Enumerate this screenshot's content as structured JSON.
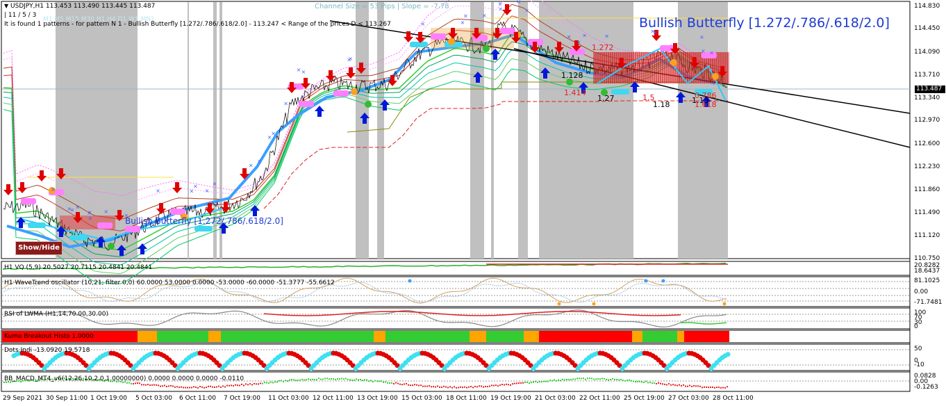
{
  "header": {
    "symbol_line": "USDJPY,H1  113.453 113.490 113.445 113.487",
    "sub_line": "| 11 / 5 / 3",
    "pattern_line": "It is found 1 patterns  -  for pattern N 1 - Bullish Butterfly [1.272/.786/.618/2.0] - 113.247 < Range of the prices D < 113.267",
    "faded_label": "M1 M5 M15 M30 H1 H4 D1 W1 MN1",
    "channel_info": "Channel Size = 53 Pips  |  Slope = -7.78"
  },
  "pattern_title": "Bullish Butterfly [1.272/.786/.618/2.0]",
  "old_pattern_label": "Bullish Butterfly [1.272/.786/.618/2.0]",
  "show_hide_label": "Show/Hide",
  "current_price": "113.487",
  "price_axis": [
    "114.830",
    "114.450",
    "114.090",
    "113.710",
    "113.340",
    "112.970",
    "112.600",
    "112.230",
    "111.860",
    "111.490",
    "111.120",
    "110.750"
  ],
  "fib_labels": [
    "1.272",
    "1.414",
    "1.27",
    "1.18",
    "1.618",
    "1.128",
    "1.5",
    "1.13",
    "0.786"
  ],
  "panes": {
    "vq": {
      "label": "H1 VQ (5,9) 20.5027 20.7115 20.4841 20.4841",
      "axis": [
        "20.8282",
        "18.6437"
      ]
    },
    "wavetrend": {
      "label": "H1 WaveTrend oscillator (10,21, filter 0,0) 60.0000 53.0000 0.0000 -53.0000 -60.0000 -51.3777 -55.6612",
      "axis": [
        "81.1025",
        "0.00",
        "-71.7481"
      ]
    },
    "rsi": {
      "label": "RSI of LWMA (H1,14,70.00,30.00)",
      "axis": [
        "100",
        "70",
        "30",
        "0"
      ]
    },
    "kumo": {
      "label": "Kumo Breakout Histo 1.0000"
    },
    "dots": {
      "label": "Dots Indi -13.0920 19.5718",
      "axis": [
        "50",
        "0",
        "-10"
      ]
    },
    "macd": {
      "label": "BB_MACD_MT4_v6(12,26,10,2.0,1.00000000) 0.0000 0.0000 0.0000 -0.0110",
      "axis": [
        "0.0828",
        "0.00",
        "-0.1263"
      ]
    }
  },
  "time_axis": [
    "29 Sep 2021",
    "30 Sep 11:00",
    "1 Oct 19:00",
    "5 Oct 03:00",
    "6 Oct 11:00",
    "7 Oct 19:00",
    "11 Oct 03:00",
    "12 Oct 11:00",
    "13 Oct 19:00",
    "15 Oct 03:00",
    "18 Oct 11:00",
    "19 Oct 19:00",
    "21 Oct 03:00",
    "22 Oct 11:00",
    "25 Oct 19:00",
    "27 Oct 03:00",
    "28 Oct 11:00"
  ],
  "colors": {
    "bull_arrow": "#0018d8",
    "bear_arrow": "#e00000",
    "session_shade": "#c0c0c0",
    "title_blue": "#1e3cd2",
    "kumo_red": "#ff0000",
    "kumo_green": "#33cc33",
    "kumo_orange": "#ffa500",
    "dots_cyan": "#3ee0f0",
    "dots_red": "#e00000"
  },
  "icons": {
    "bull_arrow": "arrow-up-icon",
    "bear_arrow": "arrow-down-icon",
    "menu": "triangle-down-icon"
  }
}
